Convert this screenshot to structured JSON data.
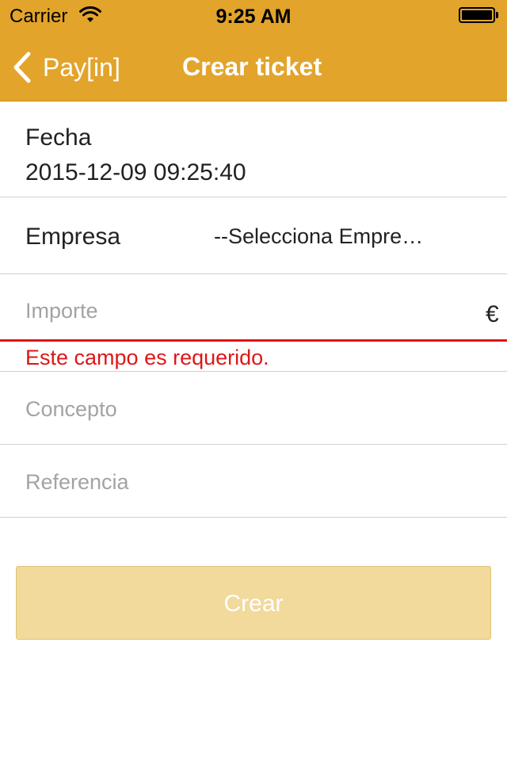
{
  "status_bar": {
    "carrier": "Carrier",
    "time": "9:25 AM",
    "icons": [
      "wifi-icon",
      "battery-icon"
    ]
  },
  "nav": {
    "back_label": "Pay[in]",
    "title": "Crear ticket",
    "color": "#e2a42b"
  },
  "form": {
    "fecha": {
      "label": "Fecha",
      "value": "2015-12-09 09:25:40"
    },
    "empresa": {
      "label": "Empresa",
      "selected": "--Selecciona Empre…"
    },
    "importe": {
      "placeholder": "Importe",
      "value": "",
      "currency": "€",
      "error": "Este campo es requerido."
    },
    "concepto": {
      "placeholder": "Concepto",
      "value": ""
    },
    "referencia": {
      "placeholder": "Referencia",
      "value": ""
    }
  },
  "actions": {
    "crear_label": "Crear"
  },
  "colors": {
    "accent": "#e2a42b",
    "error": "#e01616",
    "button_disabled": "#f2d99c"
  }
}
